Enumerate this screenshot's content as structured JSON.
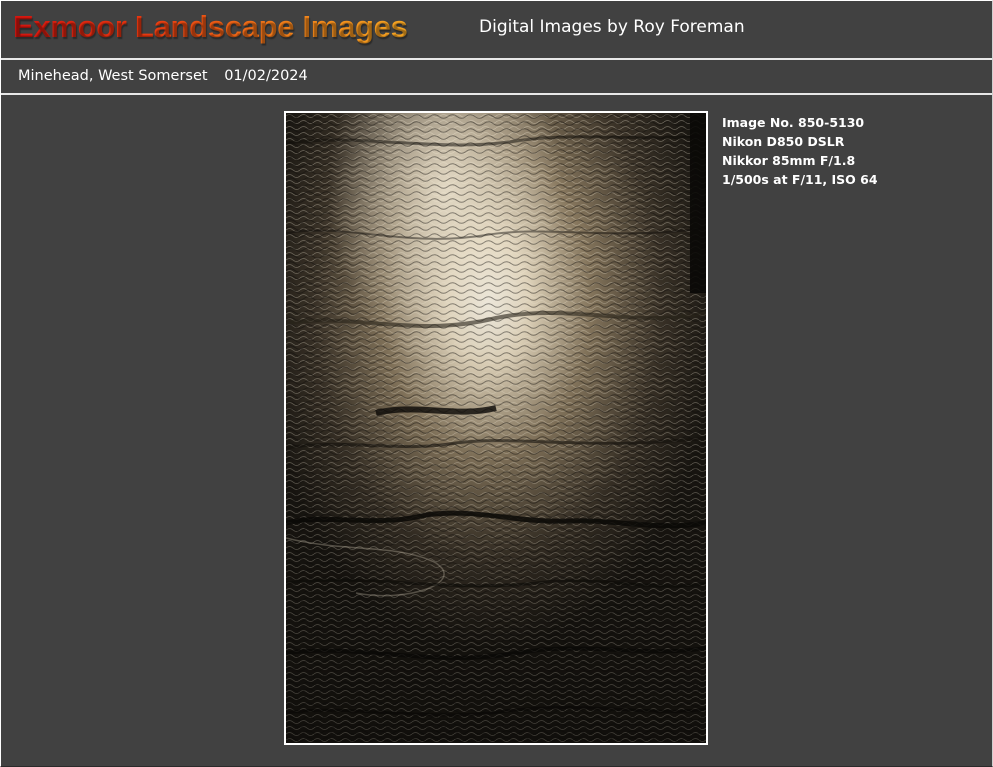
{
  "header": {
    "site_title": "Exmoor Landscape Images",
    "subtitle": "Digital Images by Roy Foreman"
  },
  "location_bar": {
    "location": "Minehead, West Somerset",
    "date": "01/02/2024"
  },
  "photo": {
    "subject": "sunlit tidal mudflats"
  },
  "info": {
    "image_no": "Image No. 850-5130",
    "camera": "Nikon D850 DSLR",
    "lens": "Nikkor 85mm F/1.8",
    "exposure": "1/500s at F/11,  ISO 64"
  },
  "colors": {
    "background": "#414141",
    "title_start": "#d4140f",
    "title_end": "#f5a623",
    "rule": "#e8e8e8"
  }
}
